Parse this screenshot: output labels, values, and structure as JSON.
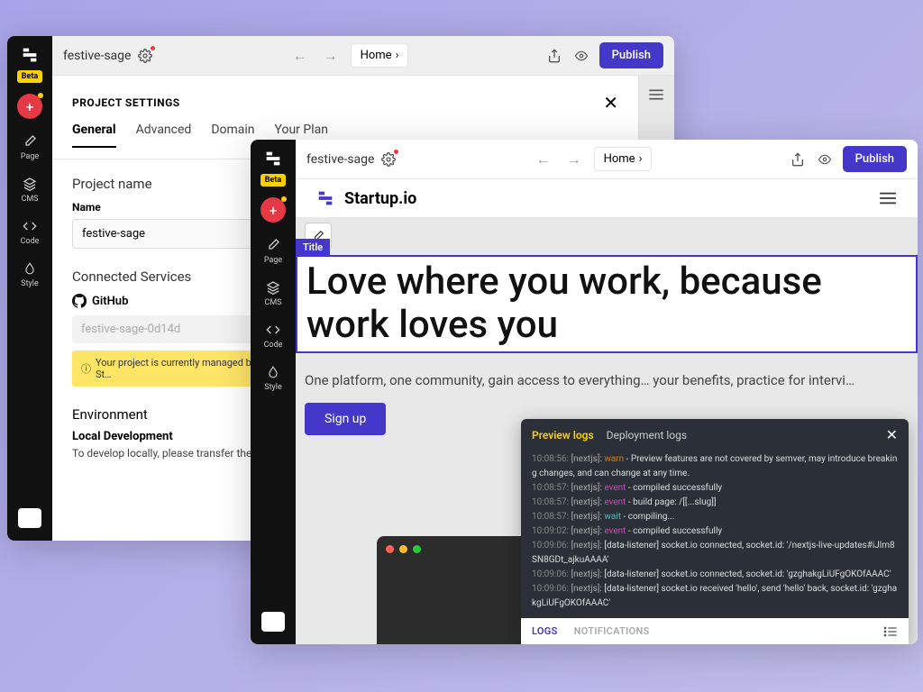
{
  "brand": {
    "beta": "Beta"
  },
  "sidebar": {
    "items": [
      {
        "label": "Page"
      },
      {
        "label": "CMS"
      },
      {
        "label": "Code"
      },
      {
        "label": "Style"
      }
    ]
  },
  "w1": {
    "topbar": {
      "project": "festive-sage",
      "crumb": "Home",
      "publish": "Publish"
    },
    "settings": {
      "title": "PROJECT SETTINGS",
      "tabs": [
        "General",
        "Advanced",
        "Domain",
        "Your Plan"
      ],
      "project_name_h": "Project name",
      "name_label": "Name",
      "name_value": "festive-sage",
      "connected_h": "Connected Services",
      "github_label": "GitHub",
      "repo_value": "festive-sage-0d14d",
      "alert": "Your project is currently managed by St…",
      "env_h": "Environment",
      "env_sub": "Local Development",
      "env_txt": "To develop locally, please transfer the…"
    }
  },
  "w2": {
    "topbar": {
      "project": "festive-sage",
      "crumb": "Home",
      "publish": "Publish"
    },
    "site": {
      "name": "Startup.io",
      "title_tag": "Title",
      "hero_title": "Love where you work, because work loves you",
      "hero_sub": "One platform, one community, gain access to everything…\nyour benefits, practice for intervi…",
      "signup": "Sign up"
    },
    "logs": {
      "tabs": [
        "Preview logs",
        "Deployment logs"
      ],
      "footer_tabs": [
        "LOGS",
        "NOTIFICATIONS"
      ],
      "lines": [
        {
          "t": "10:08:56:",
          "src": "[nextjs]:",
          "lvl": "warn",
          "msg": "- Preview features are not covered by semver, may introduce breaking changes, and can change at any time."
        },
        {
          "t": "10:08:57:",
          "src": "[nextjs]:",
          "lvl": "event",
          "msg": "- compiled successfully"
        },
        {
          "t": "10:08:57:",
          "src": "[nextjs]:",
          "lvl": "event",
          "msg": "- build page: /[[...slug]]"
        },
        {
          "t": "10:08:57:",
          "src": "[nextjs]:",
          "lvl": "wait",
          "msg": "- compiling..."
        },
        {
          "t": "10:09:02:",
          "src": "[nextjs]:",
          "lvl": "event",
          "msg": "- compiled successfully"
        },
        {
          "t": "10:09:06:",
          "src": "[nextjs]:",
          "lvl": "",
          "msg": "[data-listener] socket.io connected, socket.id: '/nextjs-live-updates#iJlm8SN8GDt_ajkuAAAA'"
        },
        {
          "t": "10:09:06:",
          "src": "[nextjs]:",
          "lvl": "",
          "msg": "[data-listener] socket.io connected, socket.id: 'gzghakgLiUFgOKOfAAAC'"
        },
        {
          "t": "10:09:06:",
          "src": "[nextjs]:",
          "lvl": "",
          "msg": "[data-listener] socket.io received 'hello', send 'hello' back, socket.id: 'gzghakgLiUFgOKOfAAAC'"
        }
      ]
    }
  }
}
